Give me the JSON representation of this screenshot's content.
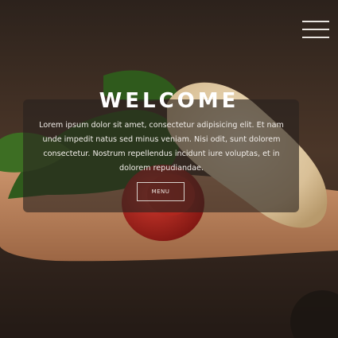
{
  "header": {
    "menu_toggle_icon": "hamburger-icon"
  },
  "hero": {
    "title": "WELCOME",
    "text": "Lorem ipsum dolor sit amet, consectetur adipisicing elit. Et nam unde impedit natus sed minus veniam. Nisi odit, sunt dolorem consectetur. Nostrum repellendus incidunt iure voluptas, et in dolorem repudiandae.",
    "button_label": "MENU"
  },
  "colors": {
    "overlay": "#28221e",
    "text": "#ffffff",
    "background": "#3a2c23"
  }
}
